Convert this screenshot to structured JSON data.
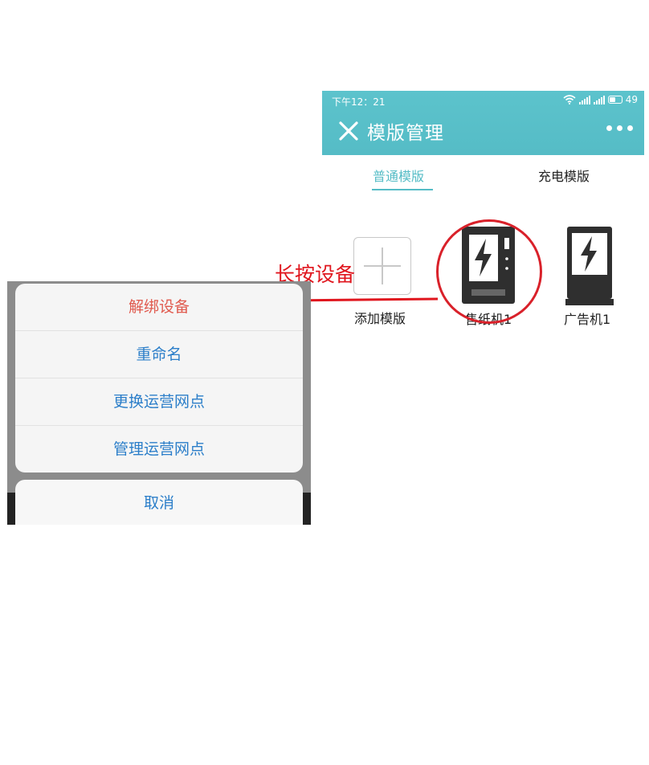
{
  "status_bar": {
    "time": "下午12：21",
    "battery_level": "49"
  },
  "header": {
    "title": "模版管理",
    "close_icon": "close-icon",
    "more_icon": "more-dots-icon"
  },
  "tabs": [
    {
      "label": "普通模版",
      "active": true
    },
    {
      "label": "充电模版",
      "active": false
    }
  ],
  "tiles": [
    {
      "label": "添加模版",
      "icon": "plus-icon"
    },
    {
      "label": "售纸机1",
      "icon": "vending-machine-icon"
    },
    {
      "label": "广告机1",
      "icon": "ad-machine-icon"
    }
  ],
  "annotation": {
    "text": "长按设备",
    "color": "#e0161e"
  },
  "action_sheet": {
    "items": [
      {
        "label": "解绑设备",
        "danger": true
      },
      {
        "label": "重命名"
      },
      {
        "label": "更换运营网点"
      },
      {
        "label": "管理运营网点"
      }
    ],
    "cancel_label": "取消"
  },
  "colors": {
    "accent": "#55bcc6",
    "link": "#2b7ec9",
    "danger": "#e05a4e",
    "highlight": "#d9212a"
  }
}
